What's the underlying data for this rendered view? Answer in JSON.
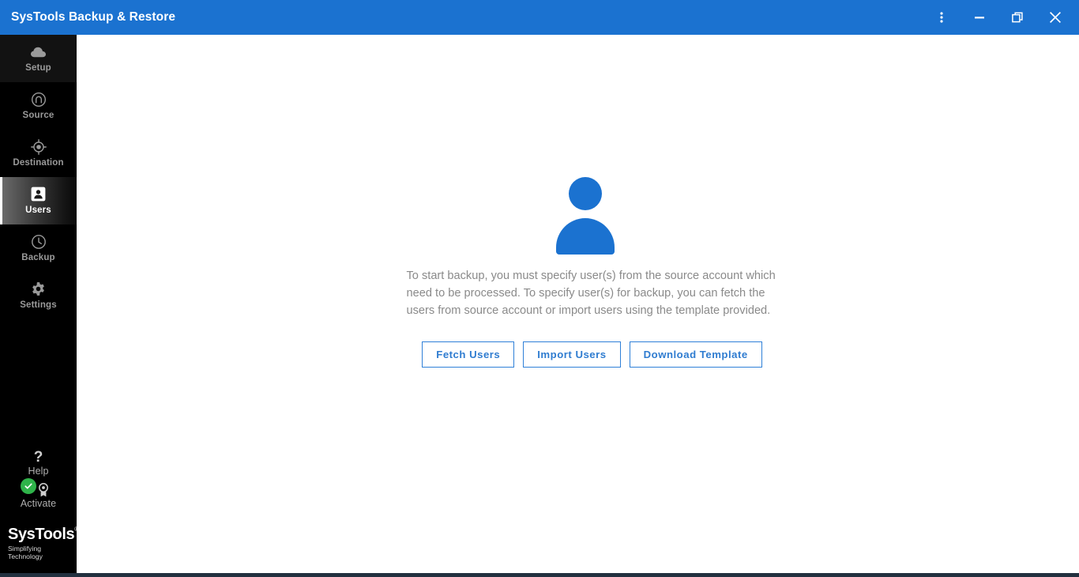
{
  "window": {
    "title": "SysTools Backup & Restore",
    "accent_color": "#1b72d0",
    "controls": [
      {
        "name": "more-options",
        "label": "More options"
      },
      {
        "name": "minimize",
        "label": "Minimize"
      },
      {
        "name": "restore",
        "label": "Restore"
      },
      {
        "name": "close",
        "label": "Close"
      }
    ]
  },
  "sidebar": {
    "background_color": "#000000",
    "items": [
      {
        "label": "Setup",
        "icon": "cloud-icon",
        "active": false
      },
      {
        "label": "Source",
        "icon": "source-icon",
        "active": false
      },
      {
        "label": "Destination",
        "icon": "target-icon",
        "active": false
      },
      {
        "label": "Users",
        "icon": "user-card-icon",
        "active": true
      },
      {
        "label": "Backup",
        "icon": "clock-icon",
        "active": false
      },
      {
        "label": "Settings",
        "icon": "gear-icon",
        "active": false
      }
    ],
    "bottom_items": [
      {
        "label": "Help",
        "icon": "question-mark-icon"
      },
      {
        "label": "Activate",
        "icon": "award-badge-icon",
        "status_icon": "green-check-icon",
        "status_color": "#2fb34a"
      }
    ],
    "logo": {
      "name": "SysTools",
      "registered_mark": "®",
      "tagline": "Simplifying Technology"
    }
  },
  "main": {
    "illustration": "user-silhouette-icon",
    "description": "To start backup, you must specify user(s) from the source account which need to be processed. To specify user(s) for backup, you can fetch the users from source account or import users using the template provided.",
    "buttons": [
      {
        "label": "Fetch Users"
      },
      {
        "label": "Import Users"
      },
      {
        "label": "Download Template"
      }
    ]
  },
  "statusbar": {
    "color": "#22303f"
  }
}
